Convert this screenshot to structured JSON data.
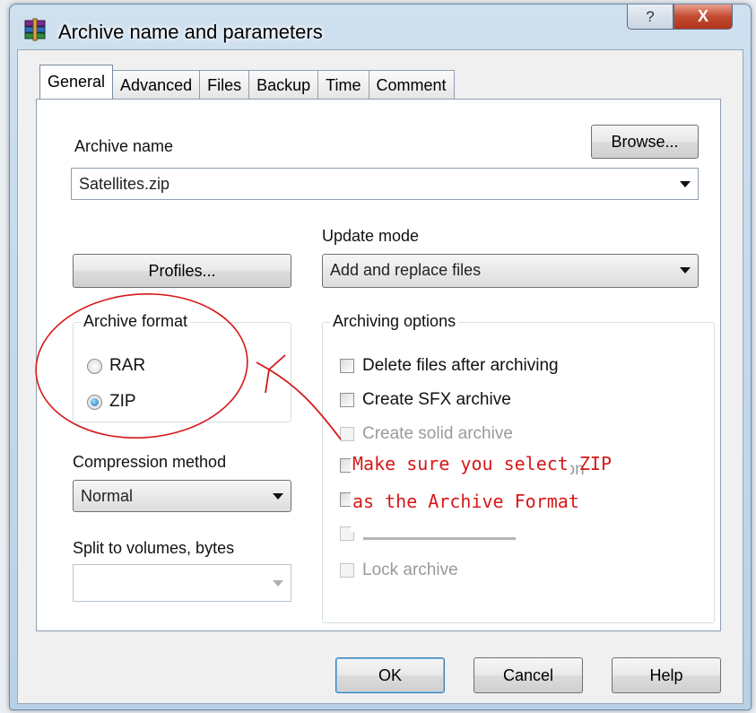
{
  "window": {
    "title": "Archive name and parameters",
    "help_glyph": "?",
    "close_glyph": "X"
  },
  "tabs": [
    {
      "label": "General",
      "active": true
    },
    {
      "label": "Advanced"
    },
    {
      "label": "Files"
    },
    {
      "label": "Backup"
    },
    {
      "label": "Time"
    },
    {
      "label": "Comment"
    }
  ],
  "archive_name": {
    "label": "Archive name",
    "value": "Satellites.zip",
    "browse_label": "Browse..."
  },
  "profiles_label": "Profiles...",
  "update_mode": {
    "label": "Update mode",
    "value": "Add and replace files"
  },
  "archive_format": {
    "title": "Archive format",
    "options": [
      {
        "label": "RAR",
        "selected": false
      },
      {
        "label": "ZIP",
        "selected": true
      }
    ]
  },
  "compression": {
    "label": "Compression method",
    "value": "Normal"
  },
  "split": {
    "label": "Split to volumes, bytes",
    "value": ""
  },
  "archiving_options": {
    "title": "Archiving options",
    "items": [
      {
        "label": "Delete files after archiving",
        "enabled": true
      },
      {
        "label": "Create SFX archive",
        "enabled": true
      },
      {
        "label": "Create solid archive",
        "enabled": false
      },
      {
        "label": "",
        "enabled": true
      },
      {
        "label": "",
        "enabled": true
      },
      {
        "label": "",
        "enabled": false
      },
      {
        "label": "Lock archive",
        "enabled": false
      }
    ],
    "partial_text": "tion"
  },
  "annotation": {
    "line1": "Make sure you select  ZIP",
    "line2": "as the Archive Format",
    "color": "#d51818"
  },
  "footer": {
    "ok": "OK",
    "cancel": "Cancel",
    "help": "Help"
  },
  "colors": {
    "titlebar": "#c5d9ec",
    "close_button": "#c34a32",
    "radio_selected": "#1c6fb8"
  }
}
